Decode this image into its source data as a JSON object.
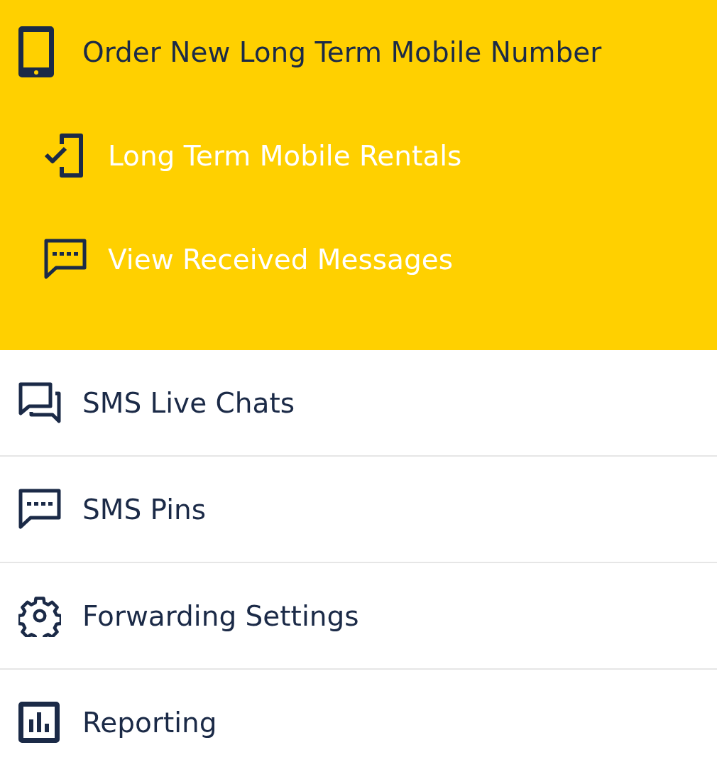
{
  "menu": {
    "items": [
      {
        "label": "Order New Long Term Mobile Number",
        "kind": "tablet",
        "expanded": true,
        "children": [
          {
            "label": "Long Term Mobile Rentals",
            "kind": "phonecheck"
          },
          {
            "label": "View Received Messages",
            "kind": "message"
          }
        ]
      },
      {
        "label": "SMS Live Chats",
        "kind": "chats",
        "expanded": false
      },
      {
        "label": "SMS Pins",
        "kind": "message",
        "expanded": false
      },
      {
        "label": "Forwarding Settings",
        "kind": "gear",
        "expanded": false
      },
      {
        "label": "Reporting",
        "kind": "chart",
        "expanded": false
      }
    ]
  }
}
